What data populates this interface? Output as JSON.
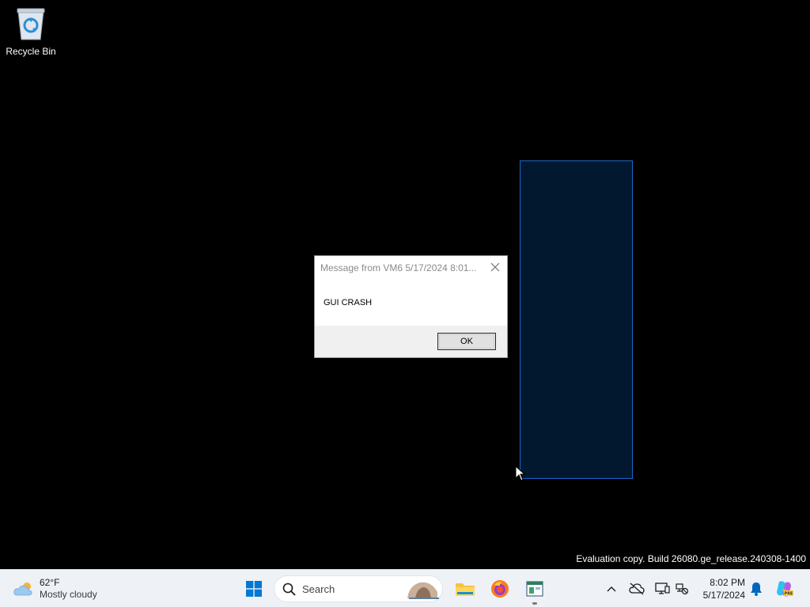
{
  "desktop": {
    "icons": [
      {
        "label": "Recycle Bin",
        "icon": "recycle-bin-icon"
      }
    ],
    "watermark": "Evaluation copy. Build 26080.ge_release.240308-1400",
    "selection_color": "#02182f"
  },
  "dialog": {
    "title": "Message from VM6 5/17/2024 8:01...",
    "message": "GUI CRASH",
    "ok_label": "OK"
  },
  "taskbar": {
    "weather": {
      "temperature": "62°F",
      "condition": "Mostly cloudy",
      "icon": "cloud-sun-icon"
    },
    "start_icon": "windows-logo-icon",
    "search": {
      "placeholder": "Search",
      "icon": "search-icon"
    },
    "pinned": [
      {
        "name": "file-explorer",
        "icon": "folder-icon"
      },
      {
        "name": "firefox",
        "icon": "firefox-icon"
      },
      {
        "name": "app",
        "icon": "app-window-icon"
      }
    ],
    "tray": {
      "icons": [
        "chevron-up-icon",
        "cloud-off-icon",
        "display-icon",
        "network-icon"
      ]
    },
    "clock": {
      "time": "8:02 PM",
      "date": "5/17/2024"
    },
    "accent": "#0067c0"
  }
}
